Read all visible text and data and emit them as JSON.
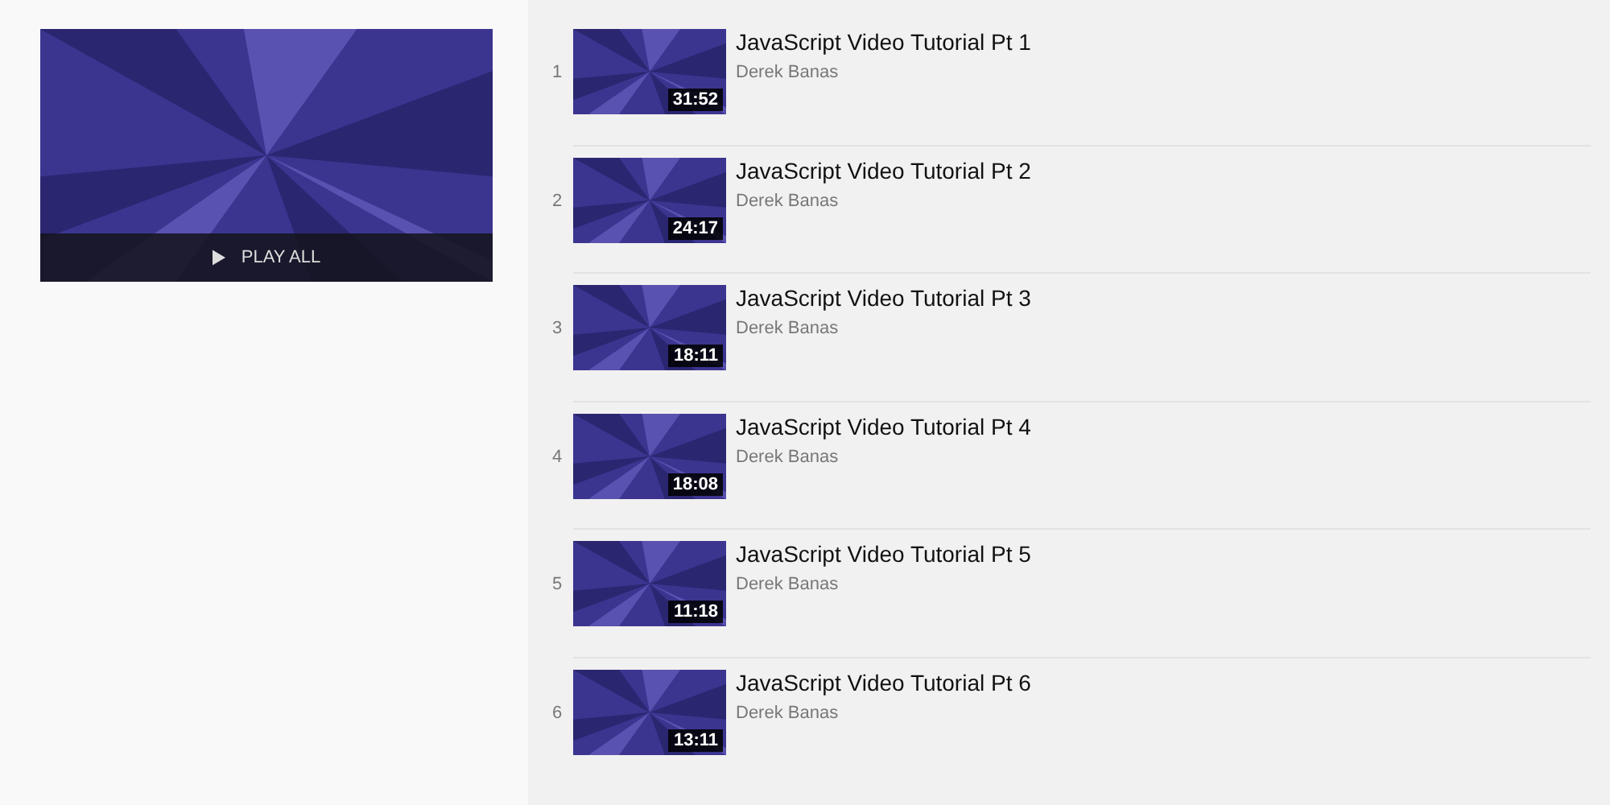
{
  "playlist": {
    "play_all": "PLAY ALL"
  },
  "videos": [
    {
      "index": "1",
      "title": "JavaScript Video Tutorial Pt 1",
      "channel": "Derek Banas",
      "duration": "31:52"
    },
    {
      "index": "2",
      "title": "JavaScript Video Tutorial Pt 2",
      "channel": "Derek Banas",
      "duration": "24:17"
    },
    {
      "index": "3",
      "title": "JavaScript Video Tutorial Pt 3",
      "channel": "Derek Banas",
      "duration": "18:11"
    },
    {
      "index": "4",
      "title": "JavaScript Video Tutorial Pt 4",
      "channel": "Derek Banas",
      "duration": "18:08"
    },
    {
      "index": "5",
      "title": "JavaScript Video Tutorial Pt 5",
      "channel": "Derek Banas",
      "duration": "11:18"
    },
    {
      "index": "6",
      "title": "JavaScript Video Tutorial Pt 6",
      "channel": "Derek Banas",
      "duration": "13:11"
    }
  ]
}
